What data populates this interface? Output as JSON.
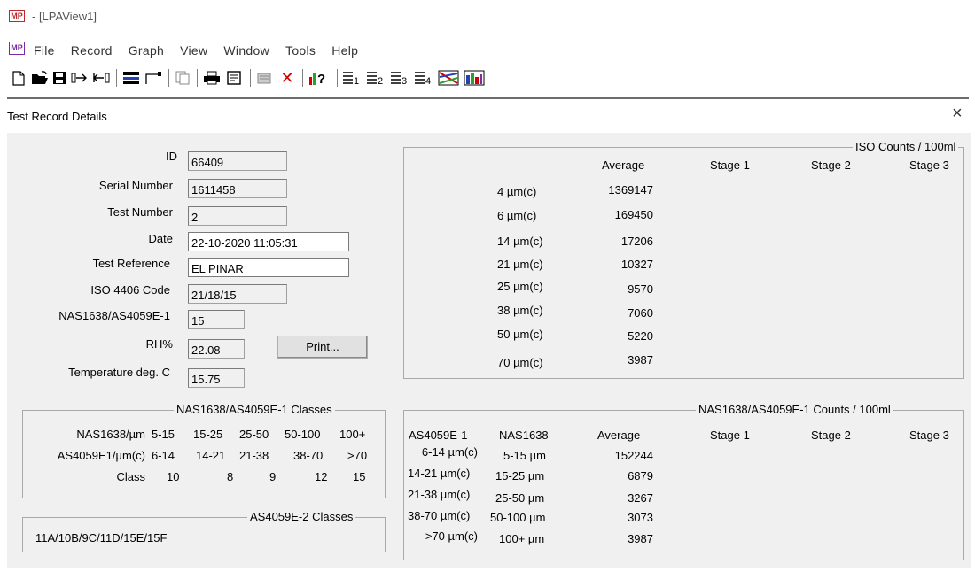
{
  "window": {
    "logo_text": "MP",
    "title": "- [LPAView1]"
  },
  "menu": {
    "logo_text": "MP",
    "items": [
      "File",
      "Record",
      "Graph",
      "View",
      "Window",
      "Tools",
      "Help"
    ]
  },
  "panel": {
    "title": "Test Record Details",
    "close": "×"
  },
  "record": {
    "id_label": "ID",
    "id_value": "66409",
    "serial_label": "Serial Number",
    "serial_value": "1611458",
    "test_number_label": "Test Number",
    "test_number_value": "2",
    "date_label": "Date",
    "date_value": "22-10-2020 11:05:31",
    "test_ref_label": "Test Reference",
    "test_ref_value": "EL PINAR",
    "iso_label": "ISO 4406 Code",
    "iso_value": "21/18/15",
    "nas_label": "NAS1638/AS4059E-1",
    "nas_value": "15",
    "rh_label": "RH%",
    "rh_value": "22.08",
    "temp_label": "Temperature deg. C",
    "temp_value": "15.75",
    "print_label": "Print..."
  },
  "nas_classes": {
    "caption": "NAS1638/AS4059E-1 Classes",
    "row1_label": "NAS1638/µm",
    "row1": [
      "5-15",
      "15-25",
      "25-50",
      "50-100",
      "100+"
    ],
    "row2_label": "AS4059E1/µm(c)",
    "row2": [
      "6-14",
      "14-21",
      "21-38",
      "38-70",
      ">70"
    ],
    "row3_label": "Class",
    "row3": [
      "10",
      "8",
      "9",
      "12",
      "15"
    ]
  },
  "as2_classes": {
    "caption": "AS4059E-2 Classes",
    "value": "11A/10B/9C/11D/15E/15F"
  },
  "iso_counts": {
    "caption": "ISO Counts / 100ml",
    "headers": [
      "Average",
      "Stage 1",
      "Stage 2",
      "Stage 3"
    ],
    "rows": [
      {
        "size": "4 µm(c)",
        "avg": "1369147"
      },
      {
        "size": "6 µm(c)",
        "avg": "169450"
      },
      {
        "size": "14 µm(c)",
        "avg": "17206"
      },
      {
        "size": "21 µm(c)",
        "avg": "10327"
      },
      {
        "size": "25 µm(c)",
        "avg": "9570"
      },
      {
        "size": "38 µm(c)",
        "avg": "7060"
      },
      {
        "size": "50 µm(c)",
        "avg": "5220"
      },
      {
        "size": "70 µm(c)",
        "avg": "3987"
      }
    ]
  },
  "nas_counts": {
    "caption": "NAS1638/AS4059E-1 Counts / 100ml",
    "headers": [
      "AS4059E-1",
      "NAS1638",
      "Average",
      "Stage 1",
      "Stage 2",
      "Stage 3"
    ],
    "rows": [
      {
        "as": "6-14 µm(c)",
        "nas": "5-15 µm",
        "avg": "152244"
      },
      {
        "as": "14-21 µm(c)",
        "nas": "15-25 µm",
        "avg": "6879"
      },
      {
        "as": "21-38 µm(c)",
        "nas": "25-50 µm",
        "avg": "3267"
      },
      {
        "as": "38-70 µm(c)",
        "nas": "50-100 µm",
        "avg": "3073"
      },
      {
        "as": ">70 µm(c)",
        "nas": "100+ µm",
        "avg": "3987"
      }
    ]
  },
  "toolbar_icons": [
    "new-icon",
    "open-icon",
    "save-icon",
    "export-icon",
    "import-icon",
    "print-preview-icon",
    "chart-icon",
    "copy-icon",
    "print-icon",
    "page-setup-icon",
    "properties-icon",
    "delete-icon",
    "help-icon",
    "stage1-icon",
    "stage2-icon",
    "stage3-icon",
    "stage4-icon",
    "graph-lines-icon",
    "graph-bars-icon"
  ]
}
